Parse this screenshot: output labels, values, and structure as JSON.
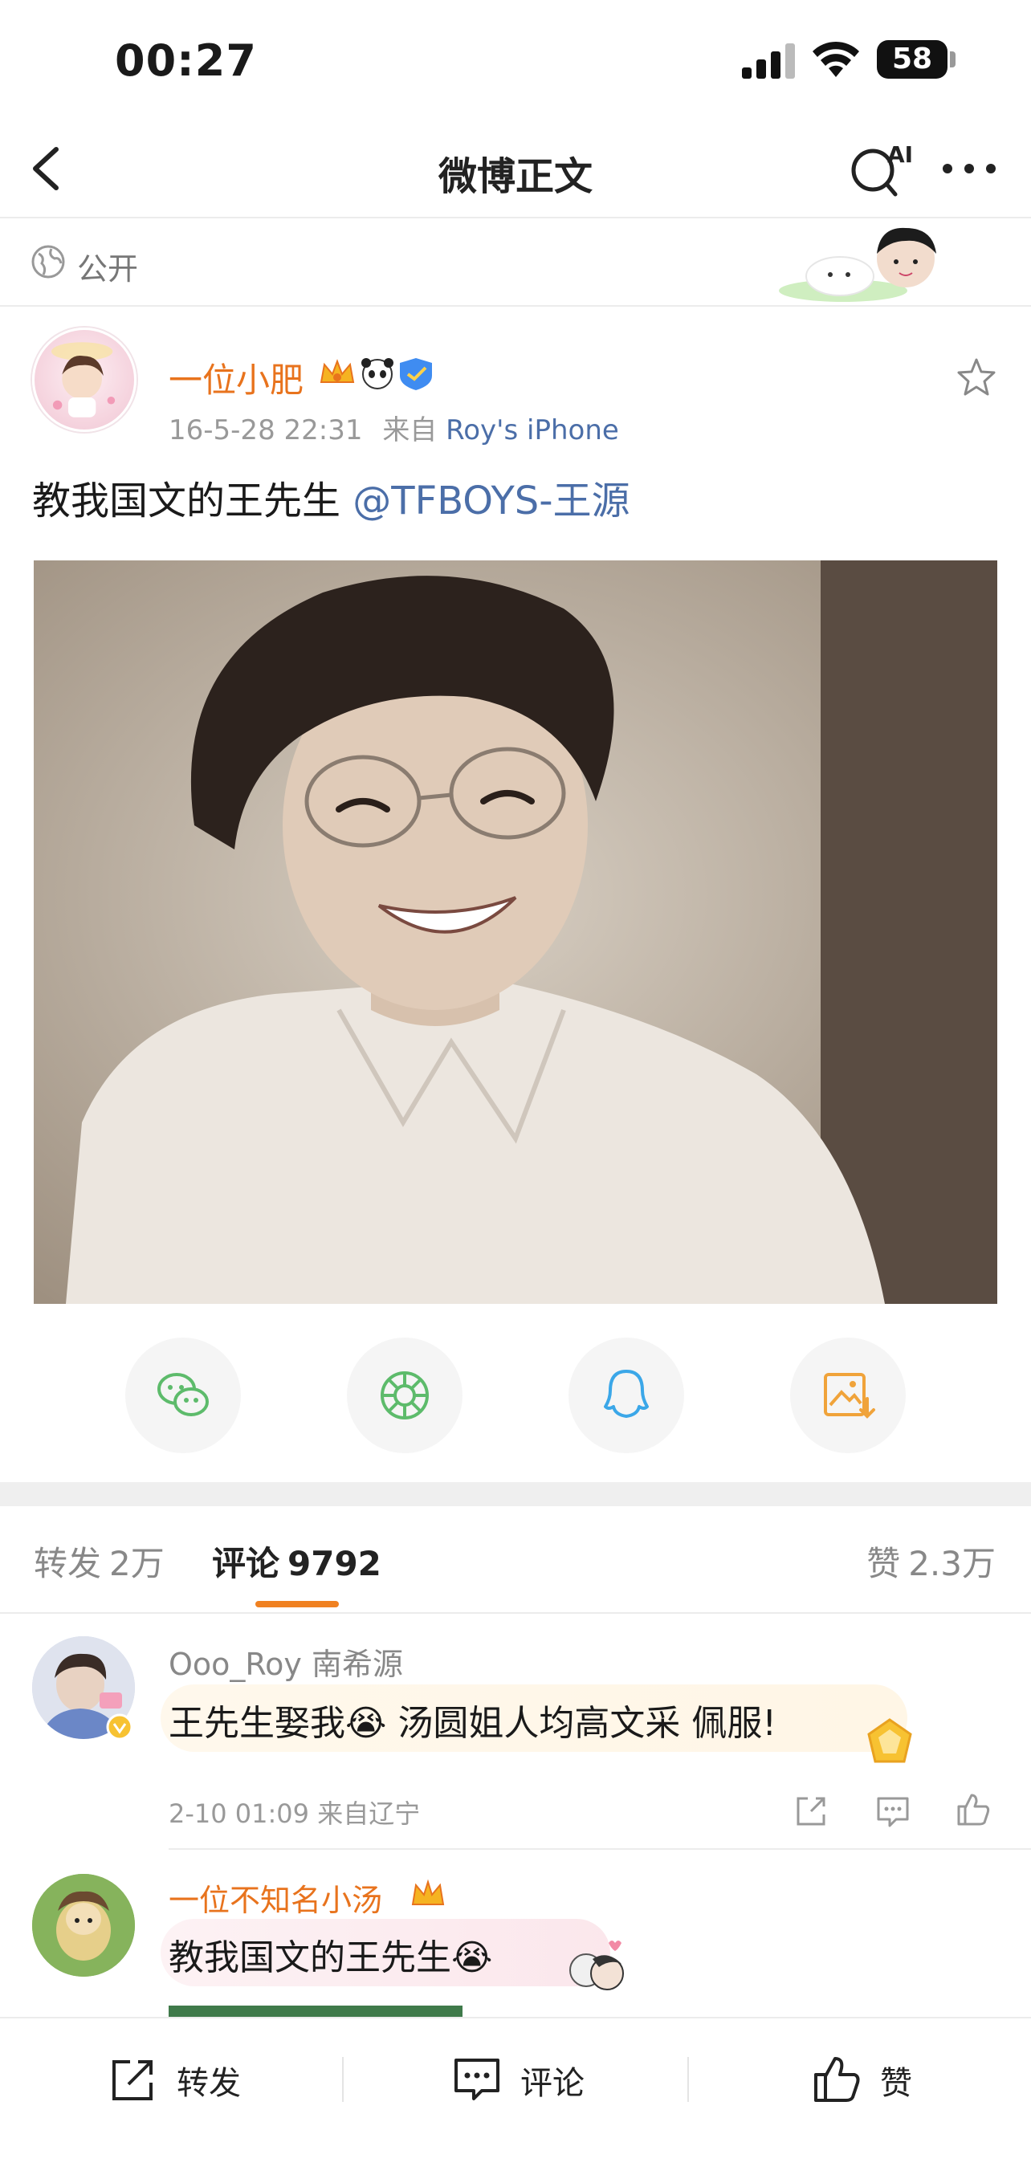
{
  "status_bar": {
    "time": "00:27",
    "battery": "58"
  },
  "nav": {
    "title": "微博正文",
    "ai_label": "AI"
  },
  "visibility": {
    "label": "公开"
  },
  "post": {
    "author": "一位小肥",
    "date": "16-5-28 22:31",
    "source_prefix": "来自",
    "device": "Roy's iPhone",
    "text": "教我国文的王先生",
    "mention": "@TFBOYS-王源"
  },
  "tabs": {
    "repost_label": "转发",
    "repost_count": "2万",
    "comment_label": "评论",
    "comment_count": "9792",
    "like_label": "赞",
    "like_count": "2.3万"
  },
  "comments": [
    {
      "name": "Ooo_Roy",
      "name_suffix": "南希源",
      "text": "王先生娶我😭 汤圆姐人均高文采 佩服!",
      "meta": "2-10 01:09 来自辽宁"
    },
    {
      "name": "一位不知名小汤",
      "text": "教我国文的王先生😭"
    }
  ],
  "bottom_bar": {
    "repost": "转发",
    "comment": "评论",
    "like": "赞"
  },
  "colors": {
    "accent_orange": "#e8731d",
    "link_blue": "#4b6ea8",
    "tab_underline": "#f08121"
  },
  "icons": [
    "back-icon",
    "ai-search-icon",
    "more-icon",
    "globe-icon",
    "star-icon",
    "wechat-icon",
    "moments-icon",
    "qq-icon",
    "save-image-icon",
    "share-icon",
    "comment-icon",
    "like-icon"
  ]
}
